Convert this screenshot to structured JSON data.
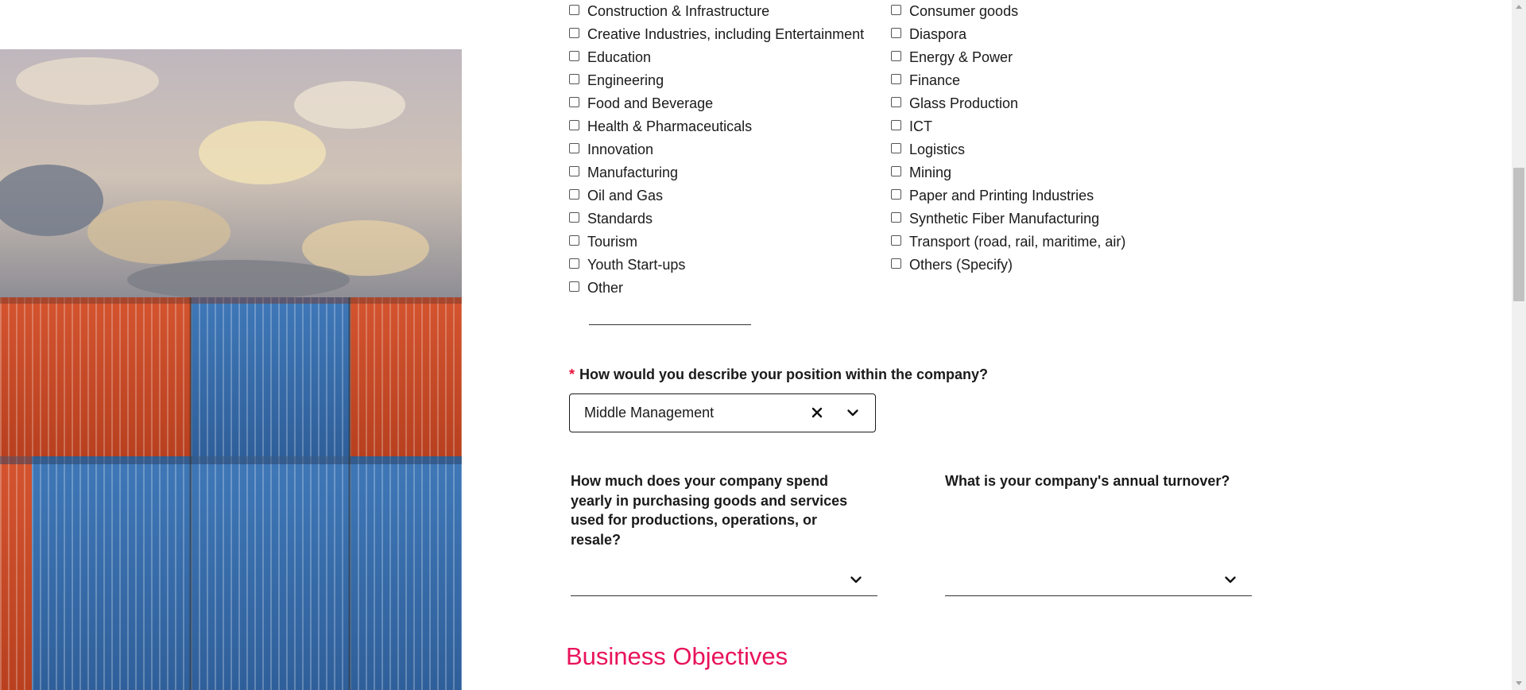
{
  "sectors": {
    "left": [
      "Construction & Infrastructure",
      "Creative Industries, including Entertainment",
      "Education",
      "Engineering",
      "Food and Beverage",
      "Health & Pharmaceuticals",
      "Innovation",
      "Manufacturing",
      "Oil and Gas",
      "Standards",
      "Tourism",
      "Youth Start-ups",
      "Other"
    ],
    "right": [
      "Consumer goods",
      "Diaspora",
      "Energy & Power",
      "Finance",
      "Glass Production",
      "ICT",
      "Logistics",
      "Mining",
      "Paper and Printing Industries",
      "Synthetic Fiber Manufacturing",
      "Transport (road, rail, maritime, air)",
      "Others (Specify)"
    ],
    "other_specify_value": ""
  },
  "position_question": {
    "required_marker": "*",
    "label": "How would you describe your position within the company?",
    "selected_value": "Middle Management"
  },
  "spend_question": {
    "label": "How much does your company spend yearly in purchasing goods and services used for productions, operations, or resale?",
    "selected_value": ""
  },
  "turnover_question": {
    "label": "What is your company's annual turnover?",
    "selected_value": ""
  },
  "section": {
    "title": "Business Objectives"
  },
  "colors": {
    "accent": "#e8135c",
    "required": "#e8123c",
    "text": "#1a1a1a"
  },
  "icons": {
    "clear": "close-icon",
    "dropdown": "chevron-down-icon"
  }
}
